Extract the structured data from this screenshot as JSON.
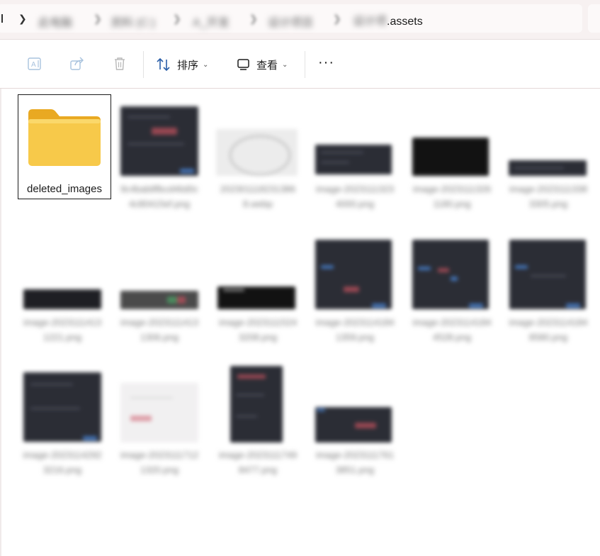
{
  "breadcrumb": {
    "items": [
      "此电脑",
      "资料 (C:)",
      "A_开发",
      "设计项目",
      "设计项目"
    ],
    "last_suffix": ".assets",
    "last_blurred_prefix": "设计项"
  },
  "toolbar": {
    "sort_label": "排序",
    "view_label": "查看",
    "more_label": "···"
  },
  "items": [
    {
      "label": "deleted_images",
      "type": "folder",
      "selected": true
    },
    {
      "label": "9c4bab8fbcd46d0c4c80415ef.png",
      "type": "image",
      "thumb": "dark"
    },
    {
      "label": "2023011182313868.webp",
      "type": "image",
      "thumb": "light"
    },
    {
      "label": "image-20231113234000.png",
      "type": "image",
      "thumb": "dark"
    },
    {
      "label": "image-20231113261180.png",
      "type": "image",
      "thumb": "black"
    },
    {
      "label": "image-20231113383305.png",
      "type": "image",
      "thumb": "dark"
    },
    {
      "label": "image-20231114131221.png",
      "type": "image",
      "thumb": "dark"
    },
    {
      "label": "image-20231114131306.png",
      "type": "image",
      "thumb": "dark"
    },
    {
      "label": "image-20231115243208.png",
      "type": "image",
      "thumb": "black"
    },
    {
      "label": "image-20231141841359.png",
      "type": "image",
      "thumb": "dark"
    },
    {
      "label": "image-20231141844528.png",
      "type": "image",
      "thumb": "dark"
    },
    {
      "label": "image-20231141848580.png",
      "type": "image",
      "thumb": "dark"
    },
    {
      "label": "image-20231142923216.png",
      "type": "image",
      "thumb": "dark"
    },
    {
      "label": "image-20231117121320.png",
      "type": "image",
      "thumb": "light"
    },
    {
      "label": "image-20231117498477.png",
      "type": "image",
      "thumb": "dark"
    },
    {
      "label": "image-20231117613851.png",
      "type": "image",
      "thumb": "dark"
    }
  ],
  "colors": {
    "folder_yellow": "#f7c94a",
    "folder_dark": "#e9a922",
    "addressbar_bg": "#f7f1f1",
    "selection_border": "#1b1b1b"
  }
}
